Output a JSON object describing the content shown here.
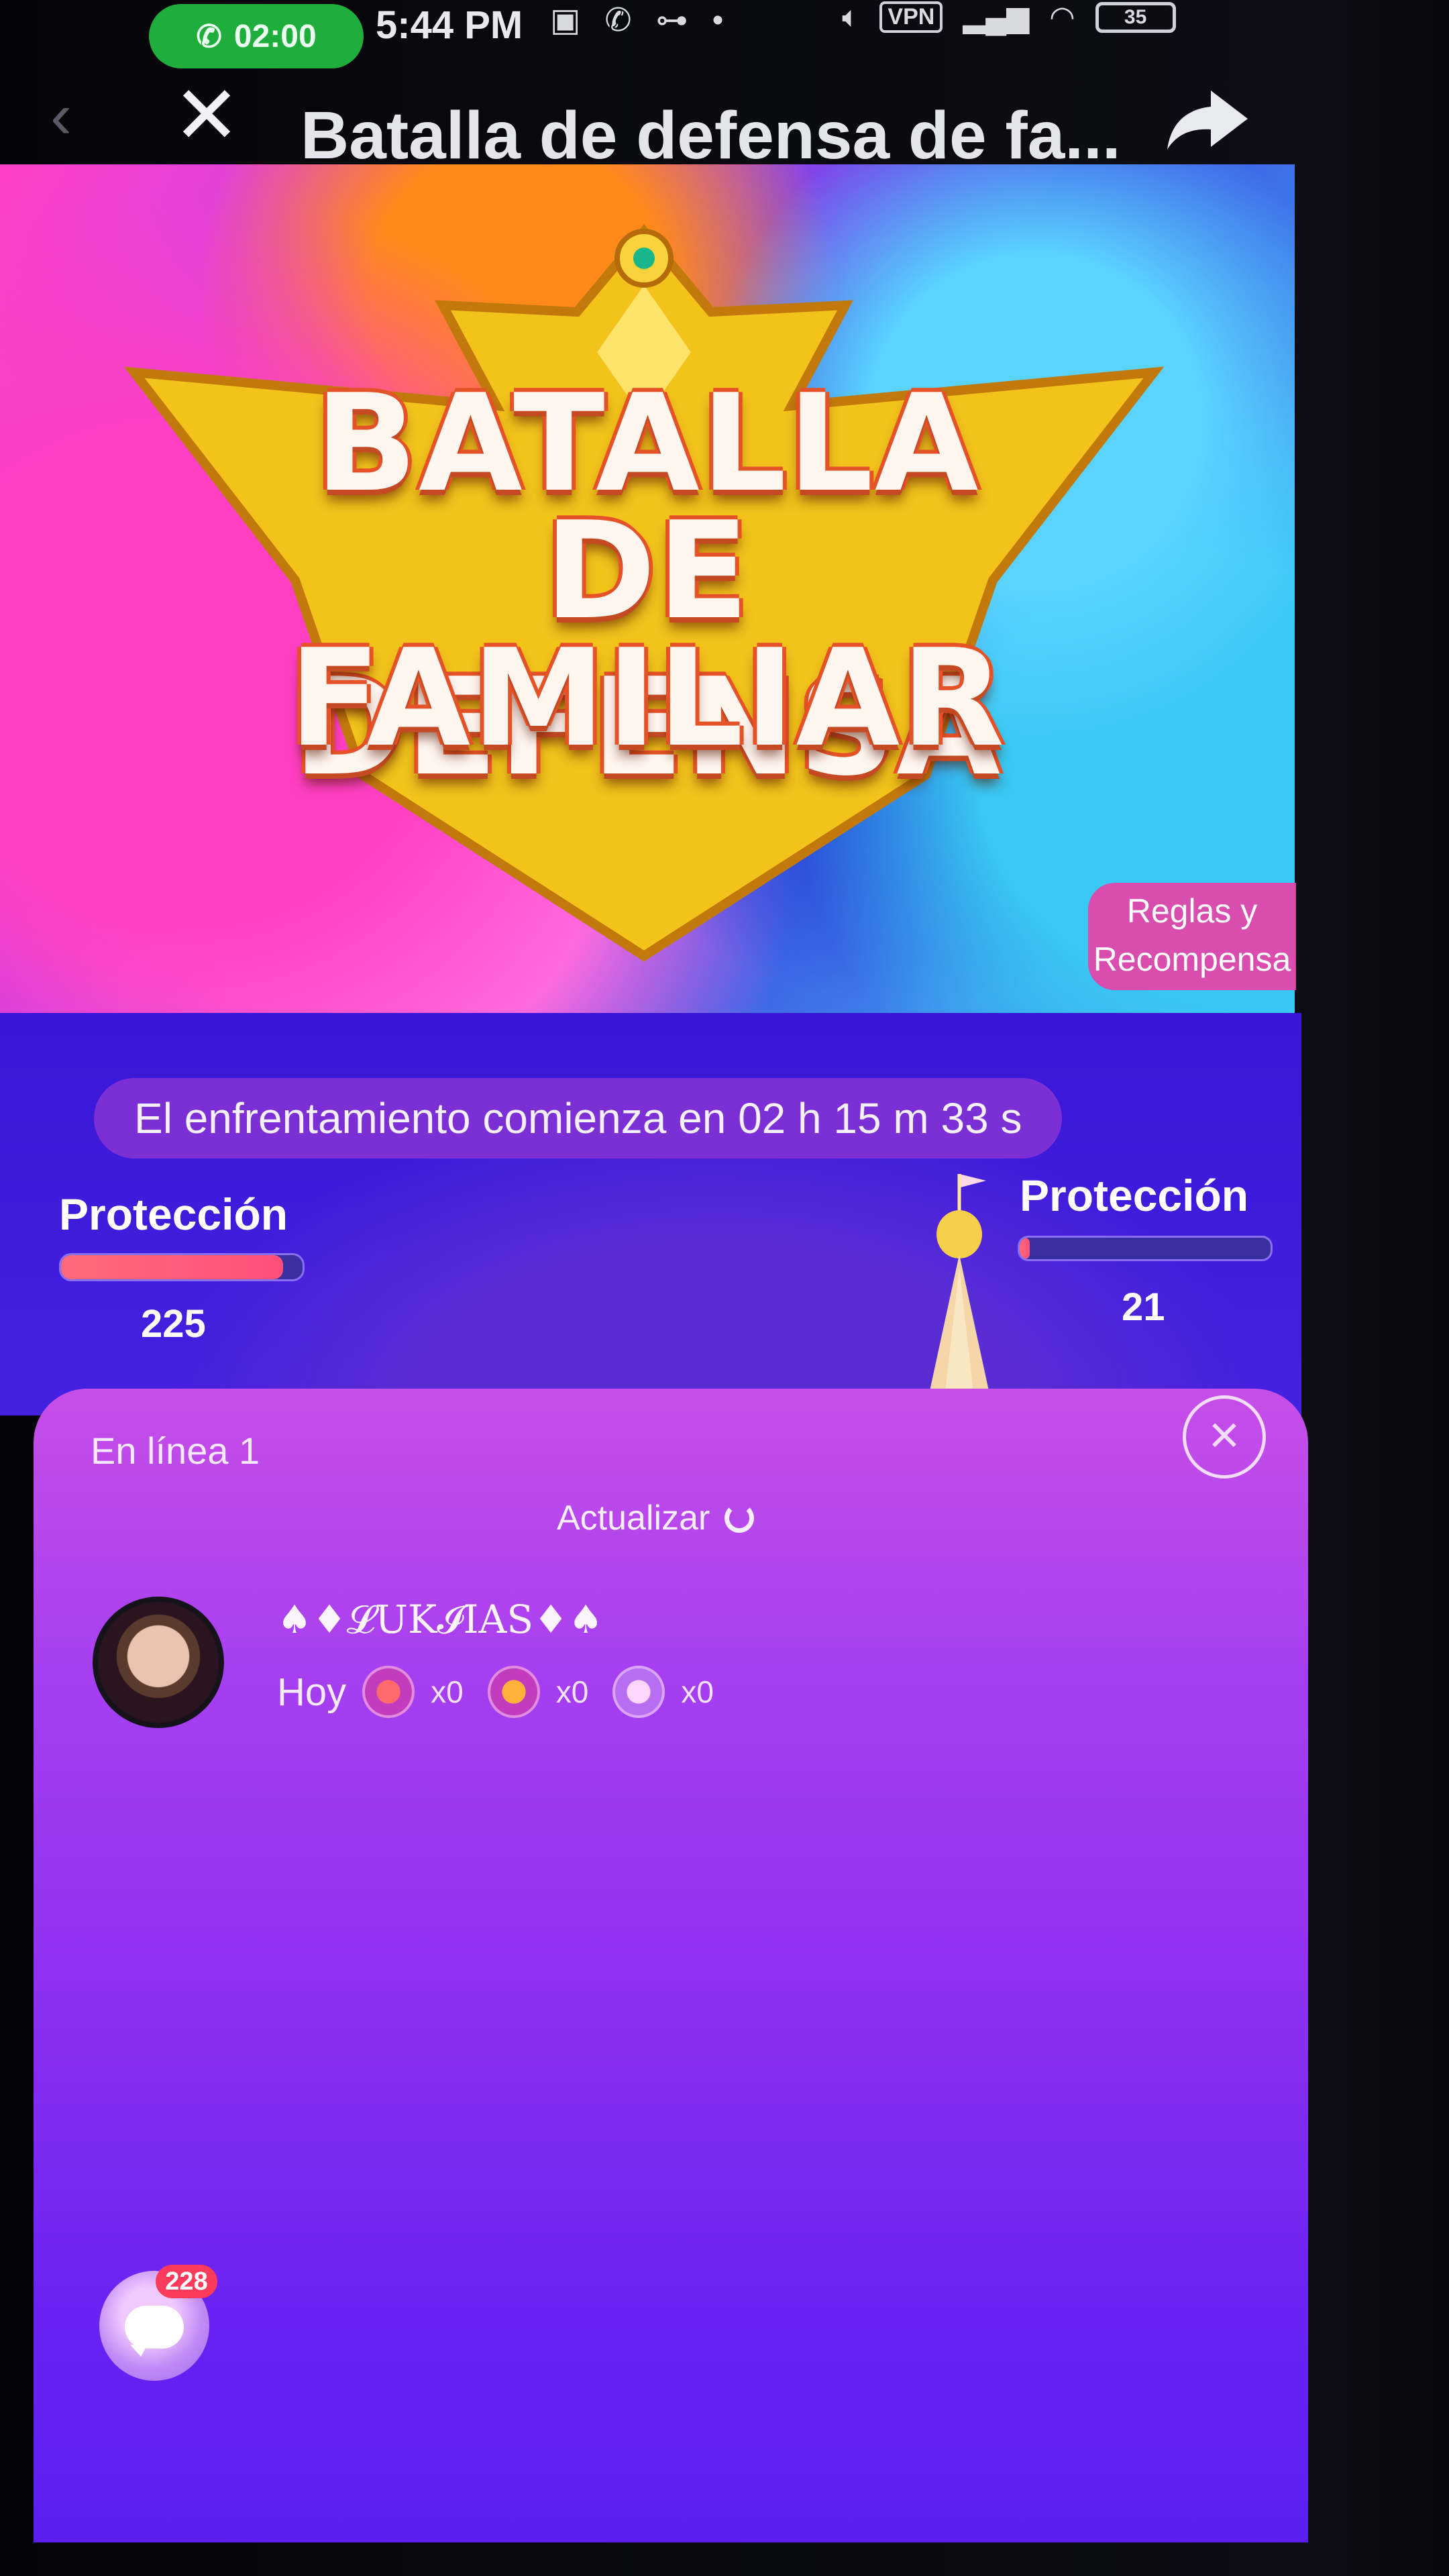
{
  "status_bar": {
    "call_time": "02:00",
    "clock": "5:44 PM",
    "vpn_label": "VPN",
    "battery": "35"
  },
  "nav": {
    "title": "Batalla de defensa de fa..."
  },
  "banner": {
    "title_lines": [
      "BATALLA",
      "DE DEFENSA",
      "FAMILIAR"
    ],
    "rules_line1": "Reglas y",
    "rules_line2": "Recompensa"
  },
  "battle": {
    "countdown": "El enfrentamiento comienza en 02 h 15 m 33 s",
    "left": {
      "label": "Protección",
      "value": "225",
      "fill_fraction": 0.92
    },
    "right": {
      "label": "Protección",
      "value": "21",
      "fill_fraction": 0.04
    }
  },
  "panel": {
    "online": "En línea 1",
    "refresh": "Actualizar",
    "user": {
      "name": "♠♦𝓛UK𝓘IAS♦♠",
      "today_label": "Hoy",
      "gifts": [
        {
          "icon": "flame-gift-icon",
          "count": "x0"
        },
        {
          "icon": "fire-gift-icon",
          "count": "x0"
        },
        {
          "icon": "shield-gift-icon",
          "count": "x0"
        }
      ]
    }
  },
  "chat": {
    "badge": "228"
  }
}
